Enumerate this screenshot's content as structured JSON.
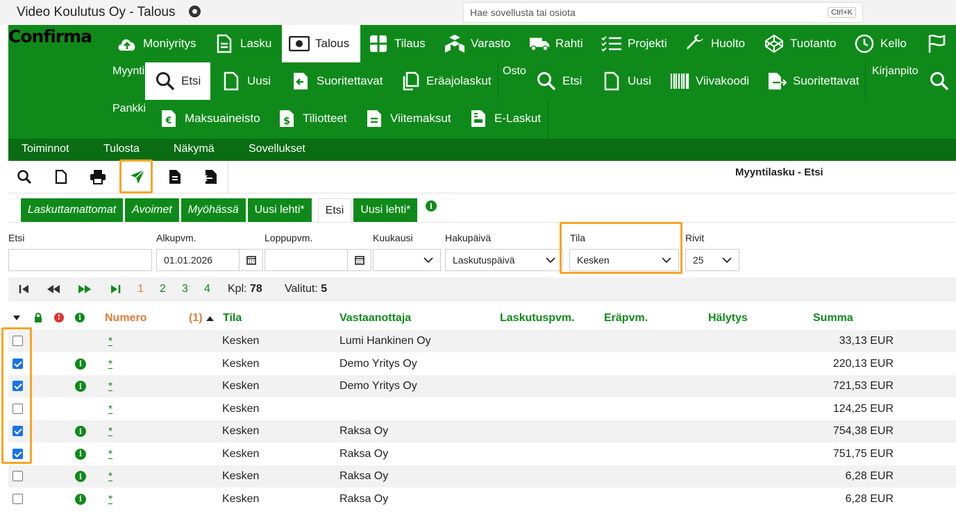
{
  "window": {
    "title": "Video Koulutus Oy - Talous",
    "search_placeholder": "Hae sovellusta tai osiota",
    "shortcut": "Ctrl+K"
  },
  "brand": {
    "logo": "Confirma",
    "green": "#0f8a1a",
    "dark_green": "#0a6d13",
    "highlight": "#f5a623"
  },
  "top_nav": [
    {
      "label": "Moniyritys",
      "icon": "cloud-upload-icon"
    },
    {
      "label": "Lasku",
      "icon": "document-icon"
    },
    {
      "label": "Talous",
      "icon": "money-icon",
      "active": true
    },
    {
      "label": "Tilaus",
      "icon": "grid-icon"
    },
    {
      "label": "Varasto",
      "icon": "boxes-icon"
    },
    {
      "label": "Rahti",
      "icon": "truck-icon"
    },
    {
      "label": "Projekti",
      "icon": "checklist-icon"
    },
    {
      "label": "Huolto",
      "icon": "wrench-icon"
    },
    {
      "label": "Tuotanto",
      "icon": "codepen-icon"
    },
    {
      "label": "Kello",
      "icon": "clock-icon"
    }
  ],
  "groups": {
    "myynti": "Myynti",
    "osto": "Osto",
    "kirjanpito": "Kirjanpito",
    "pankki": "Pankki"
  },
  "myynti_items": [
    {
      "label": "Etsi",
      "icon": "search-icon",
      "active": true
    },
    {
      "label": "Uusi",
      "icon": "new-file-icon"
    },
    {
      "label": "Suoritettavat",
      "icon": "file-arrow-icon"
    },
    {
      "label": "Eräajolaskut",
      "icon": "copy-icon"
    }
  ],
  "osto_items": [
    {
      "label": "Etsi",
      "icon": "search-icon"
    },
    {
      "label": "Uusi",
      "icon": "new-file-icon"
    },
    {
      "label": "Viivakoodi",
      "icon": "barcode-icon"
    },
    {
      "label": "Suoritettavat",
      "icon": "file-export-icon"
    }
  ],
  "pankki_items": [
    {
      "label": "Maksuaineisto",
      "icon": "file-euro-icon"
    },
    {
      "label": "Tiliotteet",
      "icon": "file-dollar-icon"
    },
    {
      "label": "Viitemaksut",
      "icon": "file-lines-icon"
    },
    {
      "label": "E-Laskut",
      "icon": "file-invoice-icon"
    }
  ],
  "menu": [
    "Toiminnot",
    "Tulosta",
    "Näkymä",
    "Sovellukset"
  ],
  "page_heading": "Myyntilasku - Etsi",
  "tabs": [
    {
      "label": "Laskuttamattomat",
      "style": "italic"
    },
    {
      "label": "Avoimet",
      "style": "italic"
    },
    {
      "label": "Myöhässä",
      "style": "italic"
    },
    {
      "label": "Uusi lehti*",
      "style": "plain"
    },
    {
      "label": "Etsi",
      "style": "active"
    },
    {
      "label": "Uusi lehti*",
      "style": "plain"
    }
  ],
  "filters": {
    "etsi": {
      "label": "Etsi",
      "value": ""
    },
    "alkupvm": {
      "label": "Alkupvm.",
      "value": "01.01.2026"
    },
    "loppupvm": {
      "label": "Loppupvm.",
      "value": ""
    },
    "kuukausi": {
      "label": "Kuukausi",
      "value": ""
    },
    "hakupaiva": {
      "label": "Hakupäivä",
      "value": "Laskutuspäivä"
    },
    "tila": {
      "label": "Tila",
      "value": "Kesken"
    },
    "rivit": {
      "label": "Rivit",
      "value": "25"
    }
  },
  "pager": {
    "pages": [
      "1",
      "2",
      "3",
      "4"
    ],
    "current": "1",
    "kpl_label": "Kpl:",
    "kpl": "78",
    "valitut_label": "Valitut:",
    "valitut": "5"
  },
  "columns": {
    "numero": "Numero",
    "sort": "(1)",
    "tila": "Tila",
    "vastaanottaja": "Vastaanottaja",
    "laskutuspvm": "Laskutuspvm.",
    "erapvm": "Eräpvm.",
    "halytys": "Hälytys",
    "summa": "Summa"
  },
  "rows": [
    {
      "checked": false,
      "info": false,
      "numero": "*",
      "tila": "Kesken",
      "vastaanottaja": "Lumi Hankinen Oy",
      "summa": "33,13 EUR"
    },
    {
      "checked": true,
      "info": true,
      "numero": "*",
      "tila": "Kesken",
      "vastaanottaja": "Demo Yritys Oy",
      "summa": "220,13 EUR"
    },
    {
      "checked": true,
      "info": true,
      "numero": "*",
      "tila": "Kesken",
      "vastaanottaja": "Demo Yritys Oy",
      "summa": "721,53 EUR"
    },
    {
      "checked": false,
      "info": false,
      "numero": "*",
      "tila": "Kesken",
      "vastaanottaja": "",
      "summa": "124,25 EUR"
    },
    {
      "checked": true,
      "info": true,
      "numero": "*",
      "tila": "Kesken",
      "vastaanottaja": "Raksa Oy",
      "summa": "754,38 EUR"
    },
    {
      "checked": true,
      "info": true,
      "numero": "*",
      "tila": "Kesken",
      "vastaanottaja": "Raksa Oy",
      "summa": "751,75 EUR"
    },
    {
      "checked": false,
      "info": true,
      "numero": "*",
      "tila": "Kesken",
      "vastaanottaja": "Raksa Oy",
      "summa": "6,28 EUR"
    },
    {
      "checked": false,
      "info": true,
      "numero": "*",
      "tila": "Kesken",
      "vastaanottaja": "Raksa Oy",
      "summa": "6,28 EUR"
    }
  ]
}
